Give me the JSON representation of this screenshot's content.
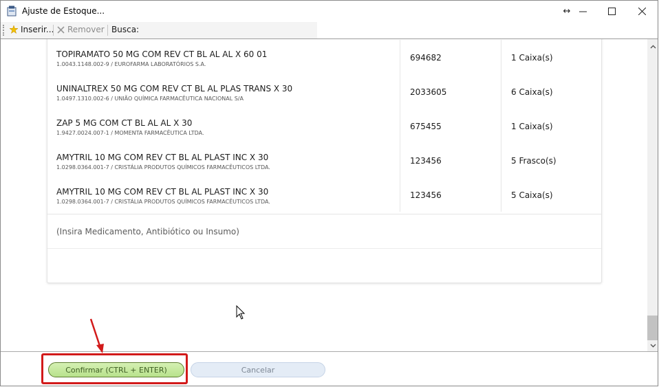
{
  "window": {
    "title": "Ajuste de Estoque...",
    "controls": {
      "resize": "↔",
      "minimize": "—",
      "maximize": "☐",
      "close": "✕"
    }
  },
  "toolbar": {
    "insert_label": "Inserir...",
    "remove_label": "Remover",
    "search_label": "Busca:"
  },
  "items": [
    {
      "name": "TOPIRAMATO 50 MG COM REV CT BL AL AL X 60 01",
      "detail": "1.0043.1148.002-9 / EUROFARMA LABORATÓRIOS S.A.",
      "code": "694682",
      "quantity": "1 Caixa(s)"
    },
    {
      "name": "UNINALTREX 50 MG COM REV CT BL AL PLAS TRANS X 30",
      "detail": "1.0497.1310.002-6 / UNIÃO QUÍMICA FARMACÊUTICA NACIONAL S/A",
      "code": "2033605",
      "quantity": "6 Caixa(s)"
    },
    {
      "name": "ZAP 5 MG COM CT BL AL AL X 30",
      "detail": "1.9427.0024.007-1 / MOMENTA FARMACÊUTICA LTDA.",
      "code": "675455",
      "quantity": "1 Caixa(s)"
    },
    {
      "name": "AMYTRIL 10 MG COM REV CT BL AL PLAST INC X 30",
      "detail": "1.0298.0364.001-7 / CRISTÁLIA PRODUTOS QUÍMICOS FARMACÊUTICOS LTDA.",
      "code": "123456",
      "quantity": "5 Frasco(s)"
    },
    {
      "name": "AMYTRIL 10 MG COM REV CT BL AL PLAST INC X 30",
      "detail": "1.0298.0364.001-7 / CRISTÁLIA PRODUTOS QUÍMICOS FARMACÊUTICOS LTDA.",
      "code": "123456",
      "quantity": "5 Caixa(s)"
    }
  ],
  "insert_placeholder": "(Insira Medicamento, Antibiótico ou Insumo)",
  "buttons": {
    "confirm_label": "Confirmar (CTRL + ENTER)",
    "cancel_label": "Cancelar"
  },
  "colors": {
    "confirm_bg": "#c6e8a0",
    "confirm_border": "#5d7d2e",
    "cancel_bg": "#e4ecf6",
    "annotation_red": "#d21a1a"
  }
}
